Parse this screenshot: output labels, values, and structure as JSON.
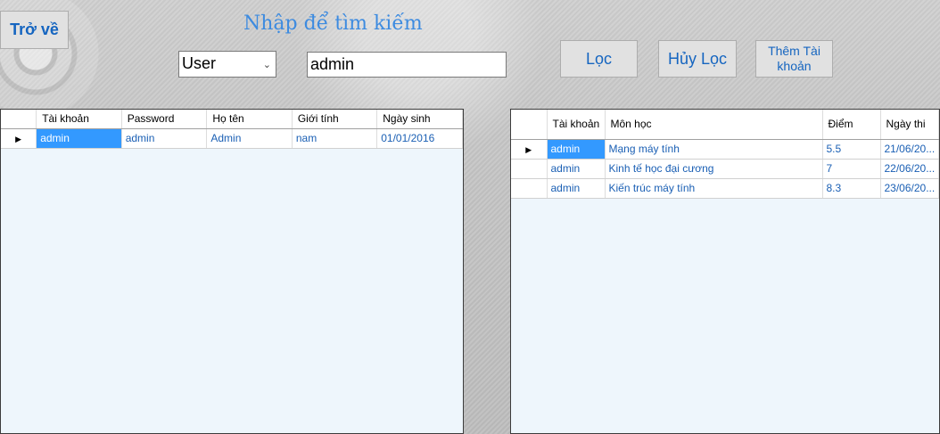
{
  "toolbar": {
    "back_label": "Trở về",
    "title": "Nhập để tìm kiếm",
    "filter_label": "Lọc",
    "unfilter_label": "Hủy Lọc",
    "add_account_label": "Thêm Tài khoản"
  },
  "search": {
    "type_selected": "User",
    "value": "admin"
  },
  "users_table": {
    "columns": [
      "Tài khoản",
      "Password",
      "Họ tên",
      "Giới tính",
      "Ngày sinh"
    ],
    "rows": [
      [
        "admin",
        "admin",
        "Admin",
        "nam",
        "01/01/2016"
      ]
    ]
  },
  "scores_table": {
    "columns": [
      "Tài khoản",
      "Môn học",
      "Điểm",
      "Ngày thi"
    ],
    "rows": [
      [
        "admin",
        "Mạng máy tính",
        "5.5",
        "21/06/20..."
      ],
      [
        "admin",
        "Kinh tế học đại cương",
        "7",
        "22/06/20..."
      ],
      [
        "admin",
        "Kiến trúc máy tính",
        "8.3",
        "23/06/20..."
      ]
    ]
  }
}
